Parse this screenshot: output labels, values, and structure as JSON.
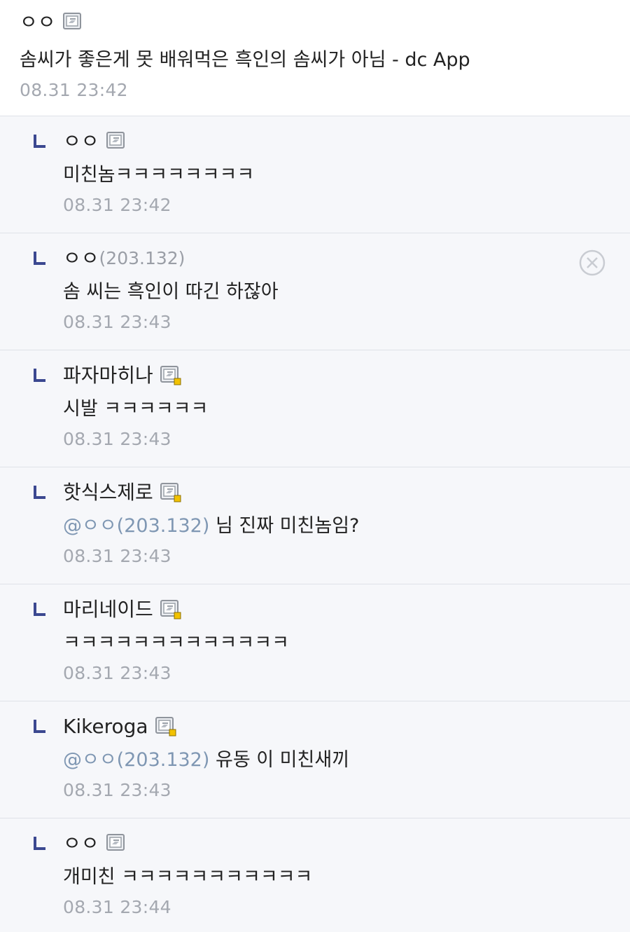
{
  "post": {
    "author": "ㅇㅇ",
    "text": "솜씨가 좋은게 못 배워먹은 흑인의 솜씨가 아님 - dc App",
    "date": "08.31 23:42"
  },
  "replies": [
    {
      "author": "ㅇㅇ",
      "ip": "",
      "badge": "fixed",
      "mention": "",
      "text": "미친놈ㅋㅋㅋㅋㅋㅋㅋㅋ",
      "date": "08.31 23:42"
    },
    {
      "author": "ㅇㅇ",
      "ip": "(203.132)",
      "badge": "",
      "mention": "",
      "text": "솜 씨는 흑인이 따긴 하잖아",
      "date": "08.31 23:43",
      "deletable": true
    },
    {
      "author": "파자마히나",
      "ip": "",
      "badge": "half",
      "mention": "",
      "text": "시발 ㅋㅋㅋㅋㅋㅋ",
      "date": "08.31 23:43"
    },
    {
      "author": "핫식스제로",
      "ip": "",
      "badge": "half",
      "mention": "@ㅇㅇ(203.132)",
      "text": " 님 진짜 미친놈임?",
      "date": "08.31 23:43"
    },
    {
      "author": "마리네이드",
      "ip": "",
      "badge": "half",
      "mention": "",
      "text": "ㅋㅋㅋㅋㅋㅋㅋㅋㅋㅋㅋㅋㅋ",
      "date": "08.31 23:43"
    },
    {
      "author": "Kikeroga",
      "ip": "",
      "badge": "half",
      "mention": "@ㅇㅇ(203.132)",
      "text": " 유동 이 미친새끼",
      "date": "08.31 23:43"
    },
    {
      "author": "ㅇㅇ",
      "ip": "",
      "badge": "fixed",
      "mention": "",
      "text": "개미친 ㅋㅋㅋㅋㅋㅋㅋㅋㅋㅋㅋ",
      "date": "08.31 23:44"
    }
  ],
  "icons": {
    "reply_arrow": "reply-arrow-icon",
    "fixed_badge": "fixed-nick-badge-icon",
    "half_badge": "half-fixed-nick-badge-icon",
    "delete": "delete-x-icon"
  },
  "colors": {
    "accent_navy": "#3b4890",
    "mention": "#7f97b3",
    "reply_bg": "#f6f7fa",
    "date": "#a4a8b0",
    "half_badge_dot": "#f2c200"
  }
}
